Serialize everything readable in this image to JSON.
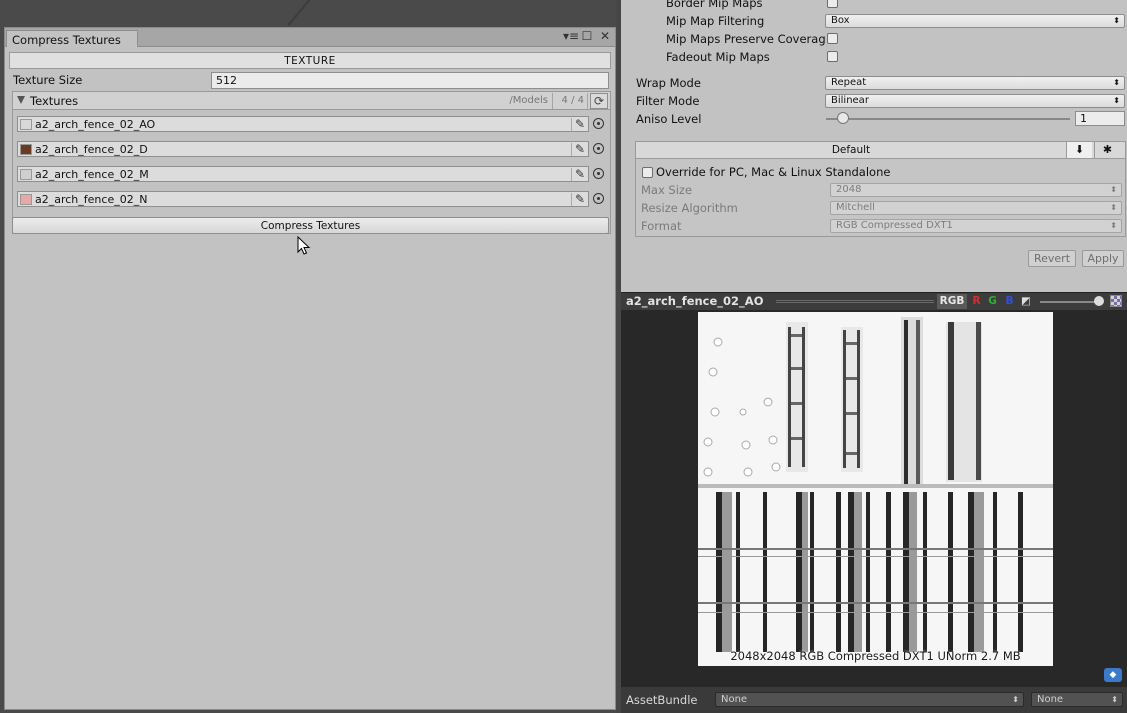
{
  "compress_window": {
    "tab_title": "Compress Textures",
    "section_header": "TEXTURE",
    "texture_size_label": "Texture Size",
    "texture_size_value": "512",
    "textures_list": {
      "title": "Textures",
      "path": "/Models",
      "count": "4 / 4",
      "items": [
        {
          "name": "a2_arch_fence_02_AO",
          "thumb_color": "#d8d8d8"
        },
        {
          "name": "a2_arch_fence_02_D",
          "thumb_color": "#6b3a22"
        },
        {
          "name": "a2_arch_fence_02_M",
          "thumb_color": "#cfcfcf"
        },
        {
          "name": "a2_arch_fence_02_N",
          "thumb_color": "#e6a8a8"
        }
      ]
    },
    "compress_button": "Compress Textures"
  },
  "inspector": {
    "border_mip_maps": "Border Mip Maps",
    "mip_map_filtering": "Mip Map Filtering",
    "mip_map_filtering_value": "Box",
    "mip_maps_preserve_coverage": "Mip Maps Preserve Coverag",
    "fadeout_mip_maps": "Fadeout Mip Maps",
    "wrap_mode": "Wrap Mode",
    "wrap_mode_value": "Repeat",
    "filter_mode": "Filter Mode",
    "filter_mode_value": "Bilinear",
    "aniso_level": "Aniso Level",
    "aniso_level_value": "1",
    "platform": {
      "title": "Default",
      "override_label": "Override for PC, Mac & Linux Standalone",
      "max_size_label": "Max Size",
      "max_size_value": "2048",
      "resize_algorithm_label": "Resize Algorithm",
      "resize_algorithm_value": "Mitchell",
      "format_label": "Format",
      "format_value": "RGB Compressed DXT1"
    },
    "revert_button": "Revert",
    "apply_button": "Apply"
  },
  "preview": {
    "title": "a2_arch_fence_02_AO",
    "channels": {
      "rgb": "RGB",
      "r": "R",
      "g": "G",
      "b": "B"
    },
    "info": "2048x2048  RGB Compressed DXT1 UNorm   2.7 MB"
  },
  "asset_bundle": {
    "label": "AssetBundle",
    "name_value": "None",
    "variant_value": "None"
  },
  "colors": {
    "accent_blue": "#3b79c9",
    "channel_r": "#d03030",
    "channel_g": "#30b030",
    "channel_b": "#3050e0"
  }
}
